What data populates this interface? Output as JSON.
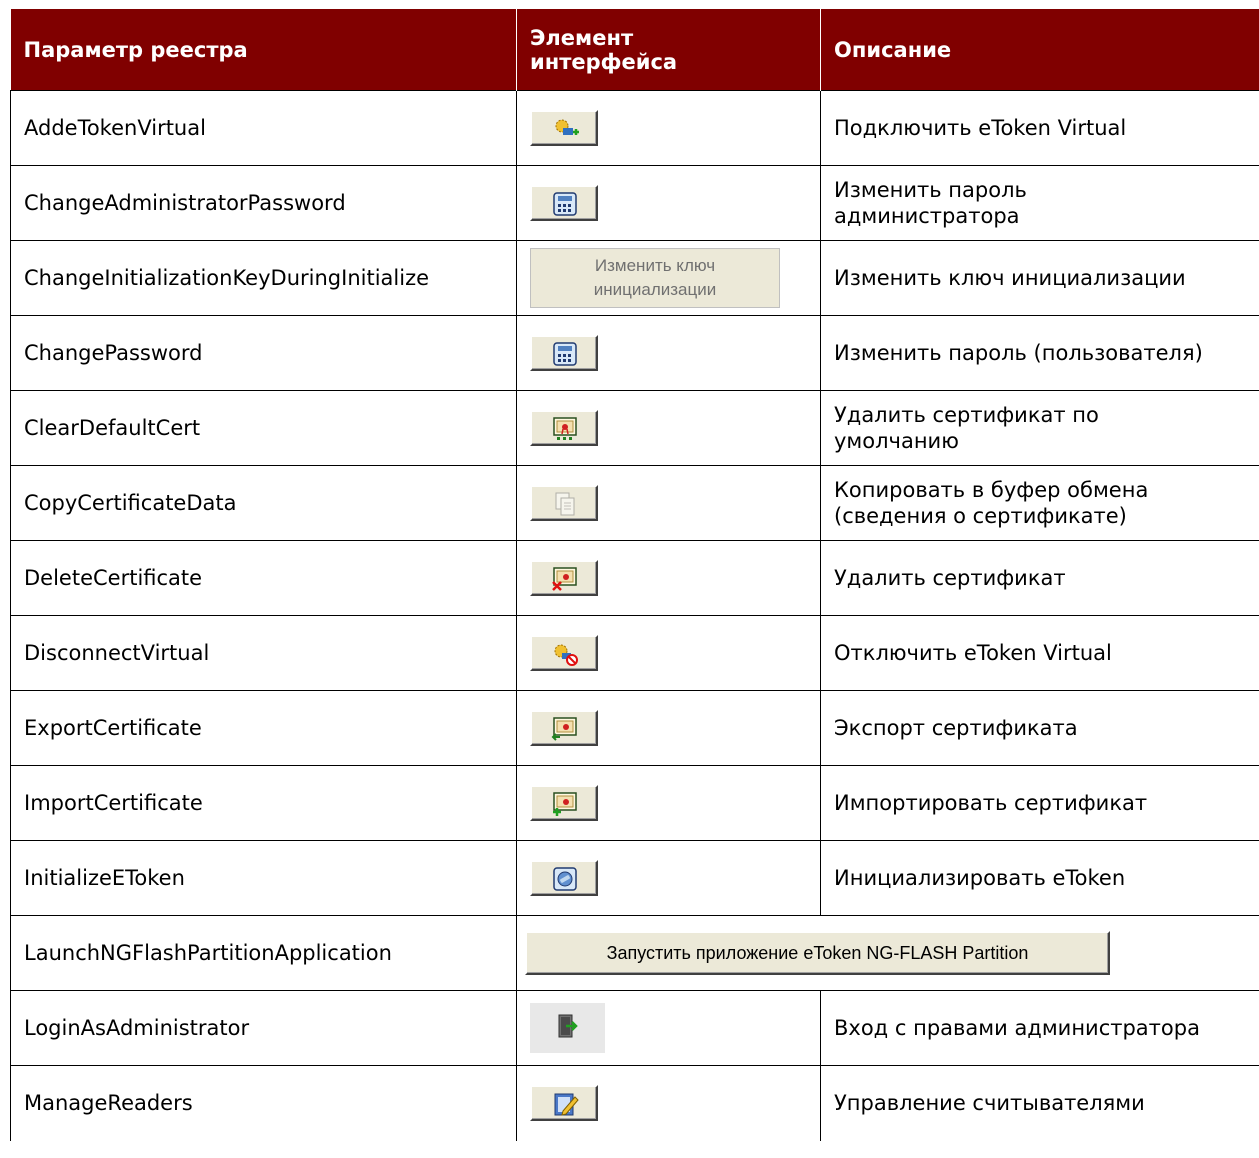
{
  "header": {
    "col1": "Параметр реестра",
    "col2_line1": "Элемент",
    "col2_line2": "интерфейса",
    "col3": "Описание"
  },
  "rows": [
    {
      "param": "AddeTokenVirtual",
      "icon": "add-virtual-token-icon",
      "desc": "Подключить eToken Virtual"
    },
    {
      "param": "ChangeAdministratorPassword",
      "icon": "password-keypad-icon",
      "desc1": "Изменить пароль",
      "desc2": "администратора"
    },
    {
      "param": "ChangeInitializationKeyDuringInitialize",
      "button_line1": "Изменить ключ",
      "button_line2": "инициализации",
      "desc": "Изменить ключ инициализации"
    },
    {
      "param": "ChangePassword",
      "icon": "password-keypad-icon",
      "desc": "Изменить пароль (пользователя)"
    },
    {
      "param": "ClearDefaultCert",
      "icon": "certificate-clear-icon",
      "desc1": "Удалить сертификат по",
      "desc2": "умолчанию"
    },
    {
      "param": "CopyCertificateData",
      "icon": "copy-document-icon",
      "desc1": "Копировать в буфер обмена",
      "desc2": "(сведения о сертификате)"
    },
    {
      "param": "DeleteCertificate",
      "icon": "certificate-delete-icon",
      "desc": "Удалить сертификат"
    },
    {
      "param": "DisconnectVirtual",
      "icon": "disconnect-virtual-token-icon",
      "desc": "Отключить eToken Virtual"
    },
    {
      "param": "ExportCertificate",
      "icon": "certificate-export-icon",
      "desc": "Экспорт сертификата"
    },
    {
      "param": "ImportCertificate",
      "icon": "certificate-import-icon",
      "desc": "Импортировать сертификат"
    },
    {
      "param": "InitializeEToken",
      "icon": "initialize-token-icon",
      "desc": "Инициализировать eToken"
    },
    {
      "param": "LaunchNGFlashPartitionApplication",
      "button": "Запустить приложение eToken NG-FLASH Partition"
    },
    {
      "param": "LoginAsAdministrator",
      "icon": "login-door-icon",
      "desc": "Вход с правами администратора"
    },
    {
      "param": "ManageReaders",
      "icon": "manage-readers-icon",
      "desc": "Управление считывателями"
    }
  ],
  "colors": {
    "header_bg": "#800000",
    "header_text": "#ffffff",
    "button_face": "#ece9d8"
  }
}
